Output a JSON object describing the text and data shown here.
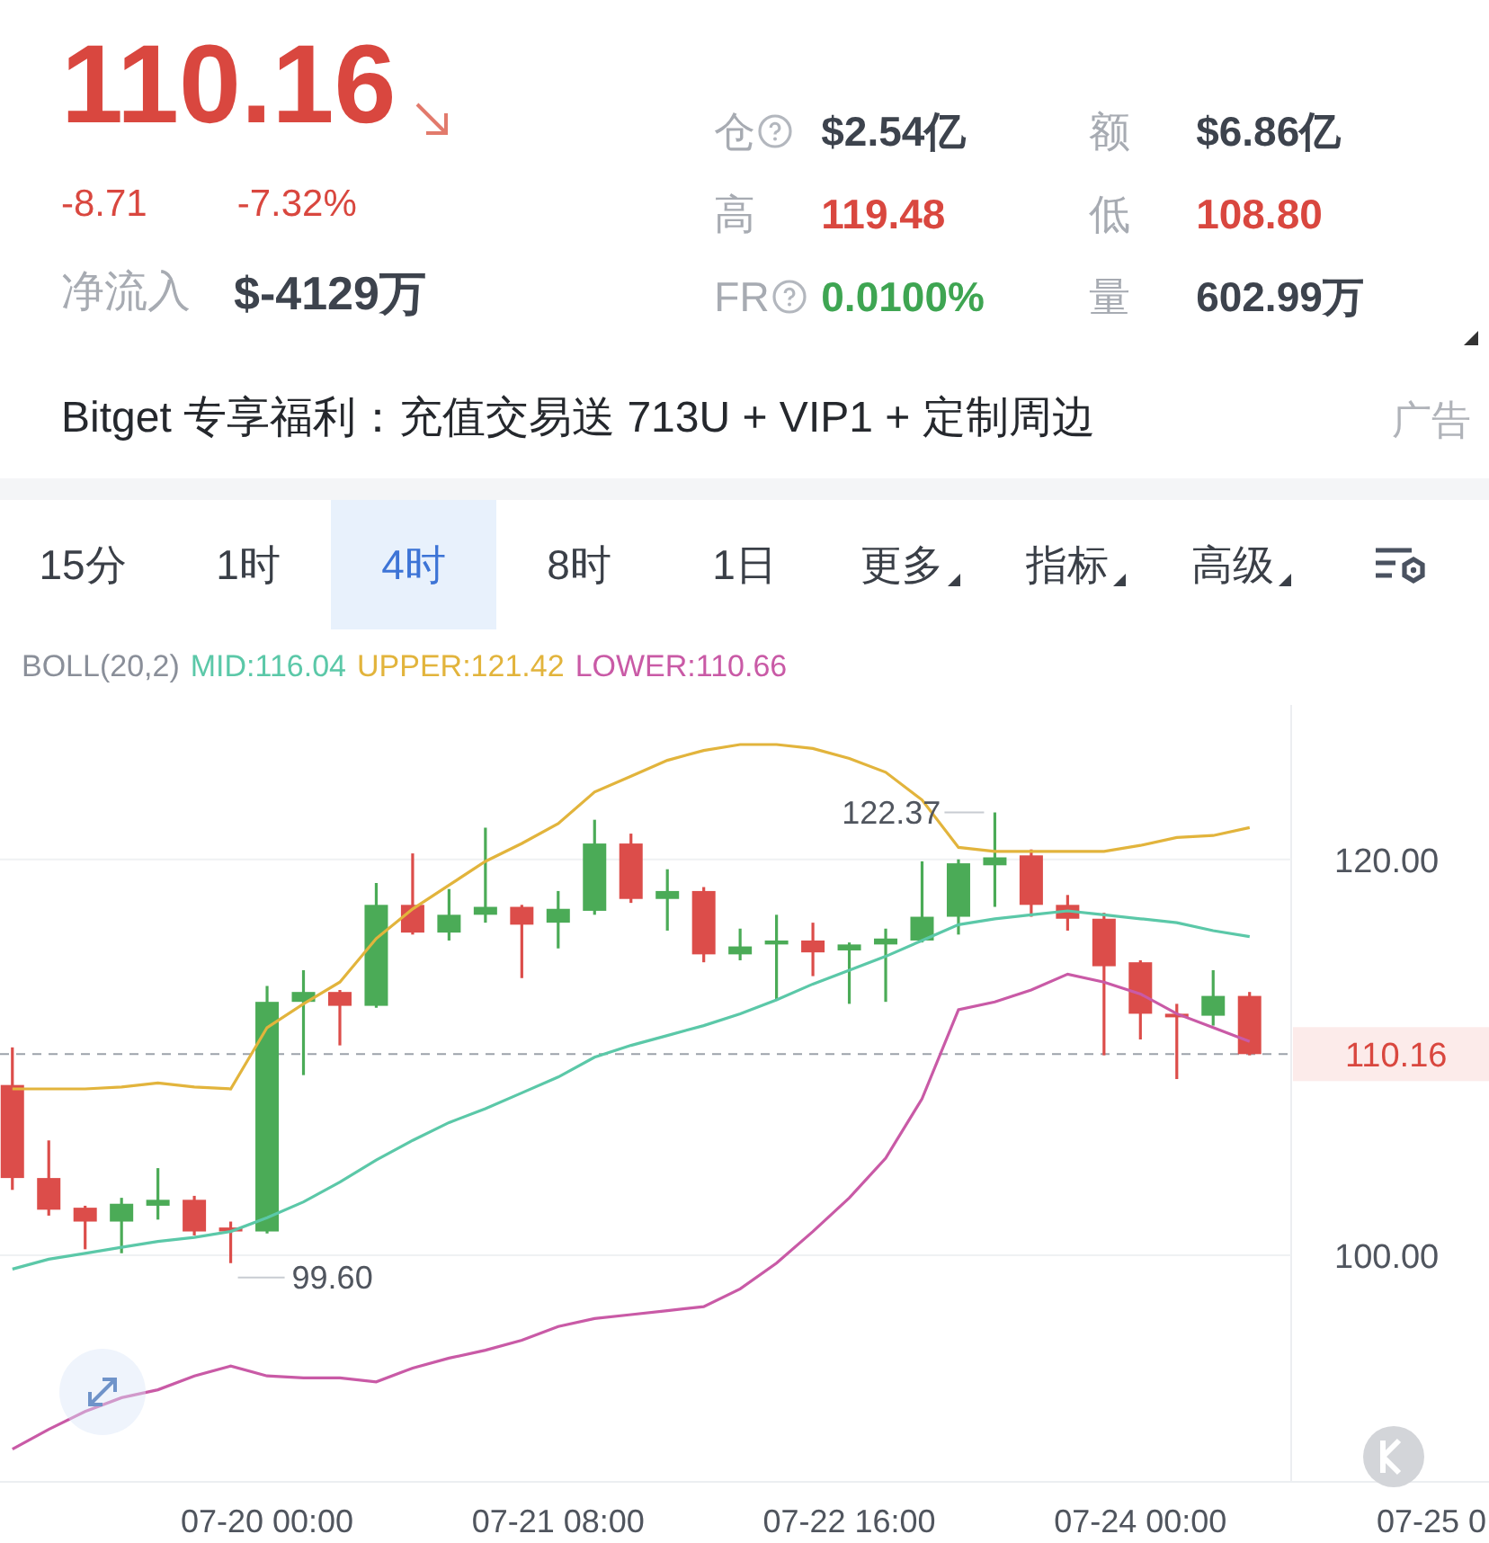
{
  "ticker": {
    "price": "110.16",
    "change": "-8.71",
    "change_pct": "-7.32%",
    "inflow_label": "净流入",
    "inflow_value": "$-4129万"
  },
  "stats": [
    {
      "label": "仓",
      "help": true,
      "value": "$2.54亿",
      "color": "#3d434d"
    },
    {
      "label": "额",
      "help": false,
      "value": "$6.86亿",
      "color": "#3d434d"
    },
    {
      "label": "高",
      "help": false,
      "value": "119.48",
      "color": "#d9473f"
    },
    {
      "label": "低",
      "help": false,
      "value": "108.80",
      "color": "#d9473f"
    },
    {
      "label": "FR",
      "help": true,
      "value": "0.0100%",
      "color": "#3ea552"
    },
    {
      "label": "量",
      "help": false,
      "value": "602.99万",
      "color": "#3d434d"
    }
  ],
  "ad": {
    "text": "Bitget 专享福利：充值交易送 713U + VIP1 + 定制周边",
    "tag": "广告"
  },
  "tabs": [
    {
      "label": "15分",
      "selected": false,
      "dropdown": false
    },
    {
      "label": "1时",
      "selected": false,
      "dropdown": false
    },
    {
      "label": "4时",
      "selected": true,
      "dropdown": false
    },
    {
      "label": "8时",
      "selected": false,
      "dropdown": false
    },
    {
      "label": "1日",
      "selected": false,
      "dropdown": false
    },
    {
      "label": "更多",
      "selected": false,
      "dropdown": true
    },
    {
      "label": "指标",
      "selected": false,
      "dropdown": true
    },
    {
      "label": "高级",
      "selected": false,
      "dropdown": true
    }
  ],
  "chart": {
    "chart_data": {
      "type": "candlestick",
      "title": "BOLL(20,2)",
      "categories": [
        null,
        null,
        null,
        null,
        null,
        null,
        null,
        "07-20 00:00",
        null,
        null,
        null,
        null,
        null,
        null,
        null,
        "07-21 08:00",
        null,
        null,
        null,
        null,
        null,
        null,
        null,
        "07-22 16:00",
        null,
        null,
        null,
        null,
        null,
        null,
        null,
        "07-24 00:00",
        null,
        null,
        null,
        null,
        null,
        null,
        null,
        "07-25 0"
      ],
      "ylim": [
        88.55,
        127.8
      ],
      "yticks": [
        {
          "value": 100,
          "label": "100.00"
        },
        {
          "value": 120,
          "label": "120.00"
        }
      ],
      "ohlc": [
        [
          108.6,
          110.5,
          103.3,
          103.9
        ],
        [
          103.9,
          105.8,
          102.0,
          102.3
        ],
        [
          102.4,
          102.5,
          100.3,
          101.7
        ],
        [
          101.7,
          102.9,
          100.1,
          102.6
        ],
        [
          102.5,
          104.4,
          101.8,
          102.8
        ],
        [
          102.8,
          103.0,
          101.0,
          101.2
        ],
        [
          101.4,
          101.7,
          99.6,
          101.2
        ],
        [
          101.2,
          113.6,
          101.1,
          112.8
        ],
        [
          112.8,
          114.4,
          109.1,
          113.3
        ],
        [
          113.3,
          113.4,
          110.6,
          112.6
        ],
        [
          112.6,
          118.8,
          112.5,
          117.7
        ],
        [
          117.7,
          120.3,
          116.2,
          116.3
        ],
        [
          116.3,
          118.5,
          115.9,
          117.2
        ],
        [
          117.2,
          121.6,
          116.8,
          117.6
        ],
        [
          117.6,
          117.7,
          114.0,
          116.7
        ],
        [
          116.8,
          118.4,
          115.5,
          117.5
        ],
        [
          117.4,
          122.0,
          117.2,
          120.8
        ],
        [
          120.8,
          121.3,
          117.8,
          118.0
        ],
        [
          118.0,
          119.5,
          116.4,
          118.4
        ],
        [
          118.4,
          118.6,
          114.8,
          115.2
        ],
        [
          115.2,
          116.5,
          114.9,
          115.6
        ],
        [
          115.7,
          117.2,
          112.9,
          115.9
        ],
        [
          115.9,
          116.8,
          114.1,
          115.3
        ],
        [
          115.4,
          115.8,
          112.7,
          115.7
        ],
        [
          115.7,
          116.5,
          112.8,
          116.0
        ],
        [
          115.9,
          119.9,
          115.8,
          117.1
        ],
        [
          117.1,
          120.0,
          116.2,
          119.8
        ],
        [
          119.7,
          122.37,
          117.6,
          120.1
        ],
        [
          120.2,
          120.5,
          117.1,
          117.7
        ],
        [
          117.7,
          118.2,
          116.4,
          117.0
        ],
        [
          117.0,
          117.3,
          110.1,
          114.6
        ],
        [
          114.8,
          114.9,
          110.9,
          112.2
        ],
        [
          112.2,
          112.7,
          108.9,
          112.1
        ],
        [
          112.1,
          114.4,
          111.6,
          113.1
        ],
        [
          113.1,
          113.3,
          110.1,
          110.16
        ],
        null,
        null,
        null,
        null,
        null
      ],
      "series": [
        {
          "name": "MID:116.04",
          "type": "line",
          "color": "#5bc8a8",
          "values": [
            99.3,
            99.8,
            100.1,
            100.4,
            100.7,
            100.9,
            101.2,
            101.9,
            102.7,
            103.7,
            104.8,
            105.8,
            106.7,
            107.4,
            108.2,
            109.0,
            110.0,
            110.6,
            111.1,
            111.6,
            112.2,
            112.9,
            113.7,
            114.4,
            115.1,
            115.9,
            116.7,
            117.0,
            117.2,
            117.4,
            117.2,
            117.0,
            116.8,
            116.4,
            116.1,
            null,
            null,
            null,
            null,
            null
          ]
        },
        {
          "name": "UPPER:121.42",
          "type": "line",
          "color": "#e2b43c",
          "values": [
            108.4,
            108.4,
            108.4,
            108.5,
            108.7,
            108.5,
            108.4,
            111.5,
            112.7,
            113.8,
            116.0,
            117.5,
            118.7,
            119.9,
            120.8,
            121.8,
            123.4,
            124.2,
            125.0,
            125.5,
            125.8,
            125.8,
            125.6,
            125.1,
            124.4,
            123.0,
            120.6,
            120.4,
            120.4,
            120.4,
            120.4,
            120.7,
            121.1,
            121.2,
            121.6,
            null,
            null,
            null,
            null,
            null
          ]
        },
        {
          "name": "LOWER:110.66",
          "type": "line",
          "color": "#c95aa6",
          "values": [
            90.2,
            91.2,
            92.1,
            92.8,
            93.2,
            93.9,
            94.4,
            93.9,
            93.8,
            93.8,
            93.6,
            94.3,
            94.8,
            95.2,
            95.7,
            96.4,
            96.8,
            97.0,
            97.2,
            97.4,
            98.3,
            99.6,
            101.2,
            102.9,
            104.9,
            107.9,
            112.4,
            112.8,
            113.4,
            114.2,
            113.8,
            113.2,
            112.2,
            111.5,
            110.8,
            null,
            null,
            null,
            null,
            null
          ]
        }
      ],
      "ref_lines": [
        {
          "axis": "y",
          "value": 110.16,
          "label": "110.16"
        }
      ],
      "annotations": [
        "122.37",
        "99.60"
      ]
    }
  }
}
